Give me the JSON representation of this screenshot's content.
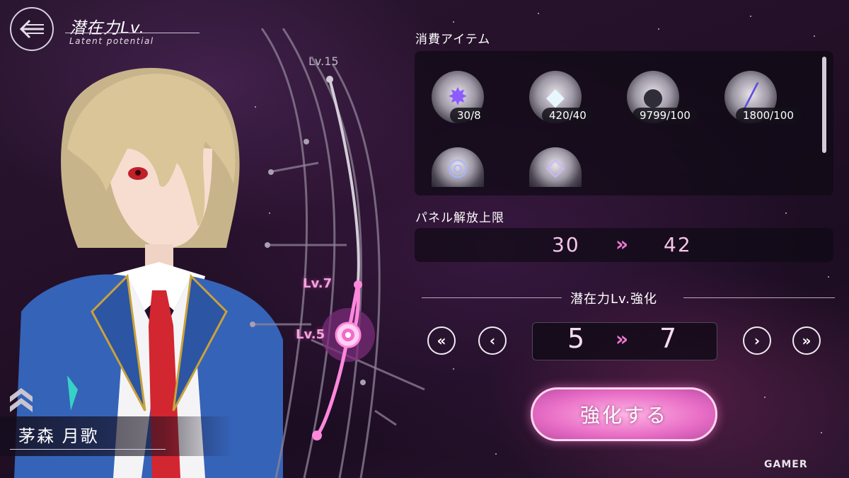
{
  "header": {
    "title": "潜在力Lv.",
    "subtitle": "Latent potential",
    "back_icon": "back-arrow-icon"
  },
  "character": {
    "name": "茅森 月歌",
    "rank_icon": "rank-chevron-icon"
  },
  "gauge": {
    "labels": {
      "max": "Lv.15",
      "target": "Lv.7",
      "current": "Lv.5"
    },
    "current_level": 5,
    "target_level": 7,
    "max_level": 15
  },
  "consumables": {
    "title": "消費アイテム",
    "items": [
      {
        "icon": "purple-crystal-icon",
        "count": "30/8"
      },
      {
        "icon": "prism-shard-icon",
        "count": "420/40"
      },
      {
        "icon": "ore-chunk-icon",
        "count": "9799/100"
      },
      {
        "icon": "light-rod-icon",
        "count": "1800/100"
      },
      {
        "icon": "ring-core-icon",
        "count": ""
      },
      {
        "icon": "crystal-vial-icon",
        "count": ""
      }
    ]
  },
  "panel_limit": {
    "title": "パネル解放上限",
    "from": "30",
    "arrow": "»",
    "to": "42"
  },
  "enhance": {
    "title": "潜在力Lv.強化",
    "from": "5",
    "arrow": "»",
    "to": "7",
    "min_label": "«",
    "dec_label": "‹",
    "inc_label": "›",
    "max_label": "»",
    "button_label": "強化する"
  },
  "watermark": "GAMER",
  "colors": {
    "accent": "#f07ad0",
    "button": "#e86ec6",
    "panel_bg": "#0e0a14"
  }
}
